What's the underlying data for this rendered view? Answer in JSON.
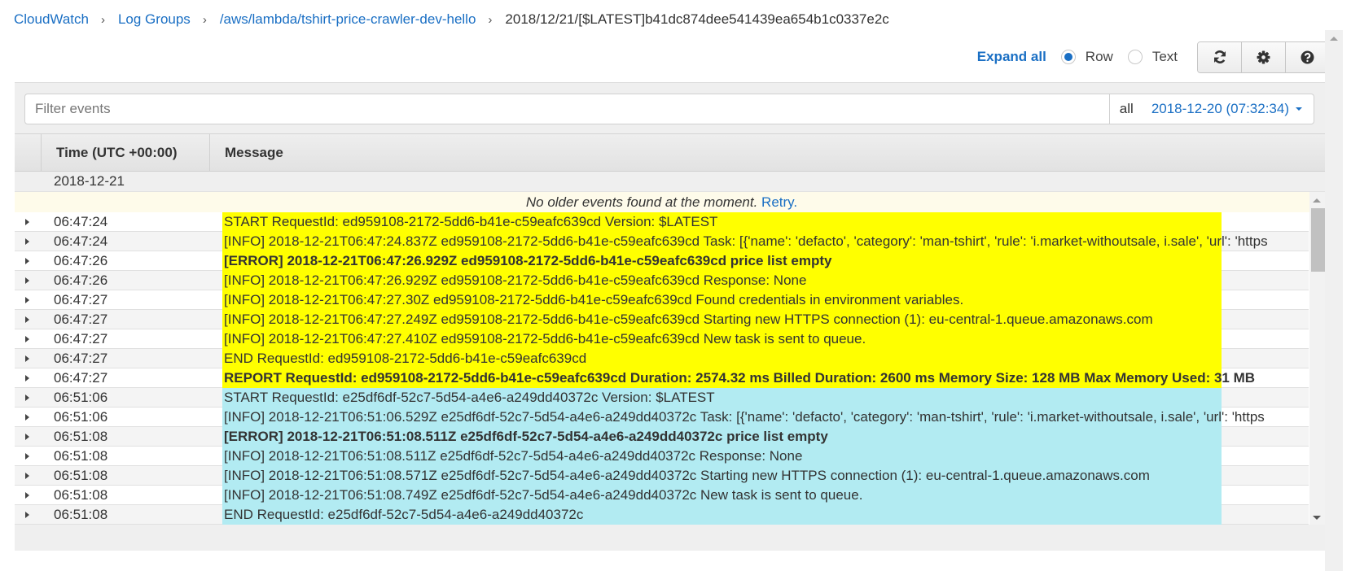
{
  "breadcrumb": {
    "items": [
      {
        "label": "CloudWatch",
        "link": true
      },
      {
        "label": "Log Groups",
        "link": true
      },
      {
        "label": "/aws/lambda/tshirt-price-crawler-dev-hello",
        "link": true
      },
      {
        "label": "2018/12/21/[$LATEST]b41dc874dee541439ea654b1c0337e2c",
        "link": false
      }
    ],
    "separator": "›"
  },
  "toolbar": {
    "expand_all": "Expand all",
    "view_mode": {
      "options": [
        "Row",
        "Text"
      ],
      "selected": "Row"
    },
    "buttons": [
      {
        "name": "refresh-button",
        "icon": "refresh-icon"
      },
      {
        "name": "settings-button",
        "icon": "gear-icon"
      },
      {
        "name": "help-button",
        "icon": "question-circle-icon"
      }
    ]
  },
  "filter": {
    "placeholder": "Filter events",
    "value": "",
    "range_label": "all",
    "range_value": "2018-12-20 (07:32:34)"
  },
  "table": {
    "headers": {
      "time": "Time (UTC +00:00)",
      "message": "Message"
    },
    "date_group": "2018-12-21",
    "notice": {
      "message": "No older events found at the moment.",
      "retry": "Retry."
    },
    "highlight_colors": {
      "request_1": "#ffff00",
      "request_2": "#b2ebf2"
    },
    "rows": [
      {
        "time": "06:47:24",
        "message": "START RequestId: ed959108-2172-5dd6-b41e-c59eafc639cd Version: $LATEST",
        "bold": false,
        "group": "request_1"
      },
      {
        "time": "06:47:24",
        "message": "[INFO] 2018-12-21T06:47:24.837Z ed959108-2172-5dd6-b41e-c59eafc639cd Task: [{'name': 'defacto', 'category': 'man-tshirt', 'rule': 'i.market-withoutsale, i.sale', 'url': 'https",
        "bold": false,
        "group": "request_1"
      },
      {
        "time": "06:47:26",
        "message": "[ERROR] 2018-12-21T06:47:26.929Z ed959108-2172-5dd6-b41e-c59eafc639cd price list empty",
        "bold": true,
        "group": "request_1"
      },
      {
        "time": "06:47:26",
        "message": "[INFO] 2018-12-21T06:47:26.929Z ed959108-2172-5dd6-b41e-c59eafc639cd Response: None",
        "bold": false,
        "group": "request_1"
      },
      {
        "time": "06:47:27",
        "message": "[INFO] 2018-12-21T06:47:27.30Z ed959108-2172-5dd6-b41e-c59eafc639cd Found credentials in environment variables.",
        "bold": false,
        "group": "request_1"
      },
      {
        "time": "06:47:27",
        "message": "[INFO] 2018-12-21T06:47:27.249Z ed959108-2172-5dd6-b41e-c59eafc639cd Starting new HTTPS connection (1): eu-central-1.queue.amazonaws.com",
        "bold": false,
        "group": "request_1"
      },
      {
        "time": "06:47:27",
        "message": "[INFO] 2018-12-21T06:47:27.410Z ed959108-2172-5dd6-b41e-c59eafc639cd New task is sent to queue.",
        "bold": false,
        "group": "request_1"
      },
      {
        "time": "06:47:27",
        "message": "END RequestId: ed959108-2172-5dd6-b41e-c59eafc639cd",
        "bold": false,
        "group": "request_1"
      },
      {
        "time": "06:47:27",
        "message": "REPORT RequestId: ed959108-2172-5dd6-b41e-c59eafc639cd Duration: 2574.32 ms Billed Duration: 2600 ms Memory Size: 128 MB Max Memory Used: 31 MB",
        "bold": true,
        "group": "request_1"
      },
      {
        "time": "06:51:06",
        "message": "START RequestId: e25df6df-52c7-5d54-a4e6-a249dd40372c Version: $LATEST",
        "bold": false,
        "group": "request_2"
      },
      {
        "time": "06:51:06",
        "message": "[INFO] 2018-12-21T06:51:06.529Z e25df6df-52c7-5d54-a4e6-a249dd40372c Task: [{'name': 'defacto', 'category': 'man-tshirt', 'rule': 'i.market-withoutsale, i.sale', 'url': 'https",
        "bold": false,
        "group": "request_2"
      },
      {
        "time": "06:51:08",
        "message": "[ERROR] 2018-12-21T06:51:08.511Z e25df6df-52c7-5d54-a4e6-a249dd40372c price list empty",
        "bold": true,
        "group": "request_2"
      },
      {
        "time": "06:51:08",
        "message": "[INFO] 2018-12-21T06:51:08.511Z e25df6df-52c7-5d54-a4e6-a249dd40372c Response: None",
        "bold": false,
        "group": "request_2"
      },
      {
        "time": "06:51:08",
        "message": "[INFO] 2018-12-21T06:51:08.571Z e25df6df-52c7-5d54-a4e6-a249dd40372c Starting new HTTPS connection (1): eu-central-1.queue.amazonaws.com",
        "bold": false,
        "group": "request_2"
      },
      {
        "time": "06:51:08",
        "message": "[INFO] 2018-12-21T06:51:08.749Z e25df6df-52c7-5d54-a4e6-a249dd40372c New task is sent to queue.",
        "bold": false,
        "group": "request_2"
      },
      {
        "time": "06:51:08",
        "message": "END RequestId: e25df6df-52c7-5d54-a4e6-a249dd40372c",
        "bold": false,
        "group": "request_2"
      }
    ]
  }
}
